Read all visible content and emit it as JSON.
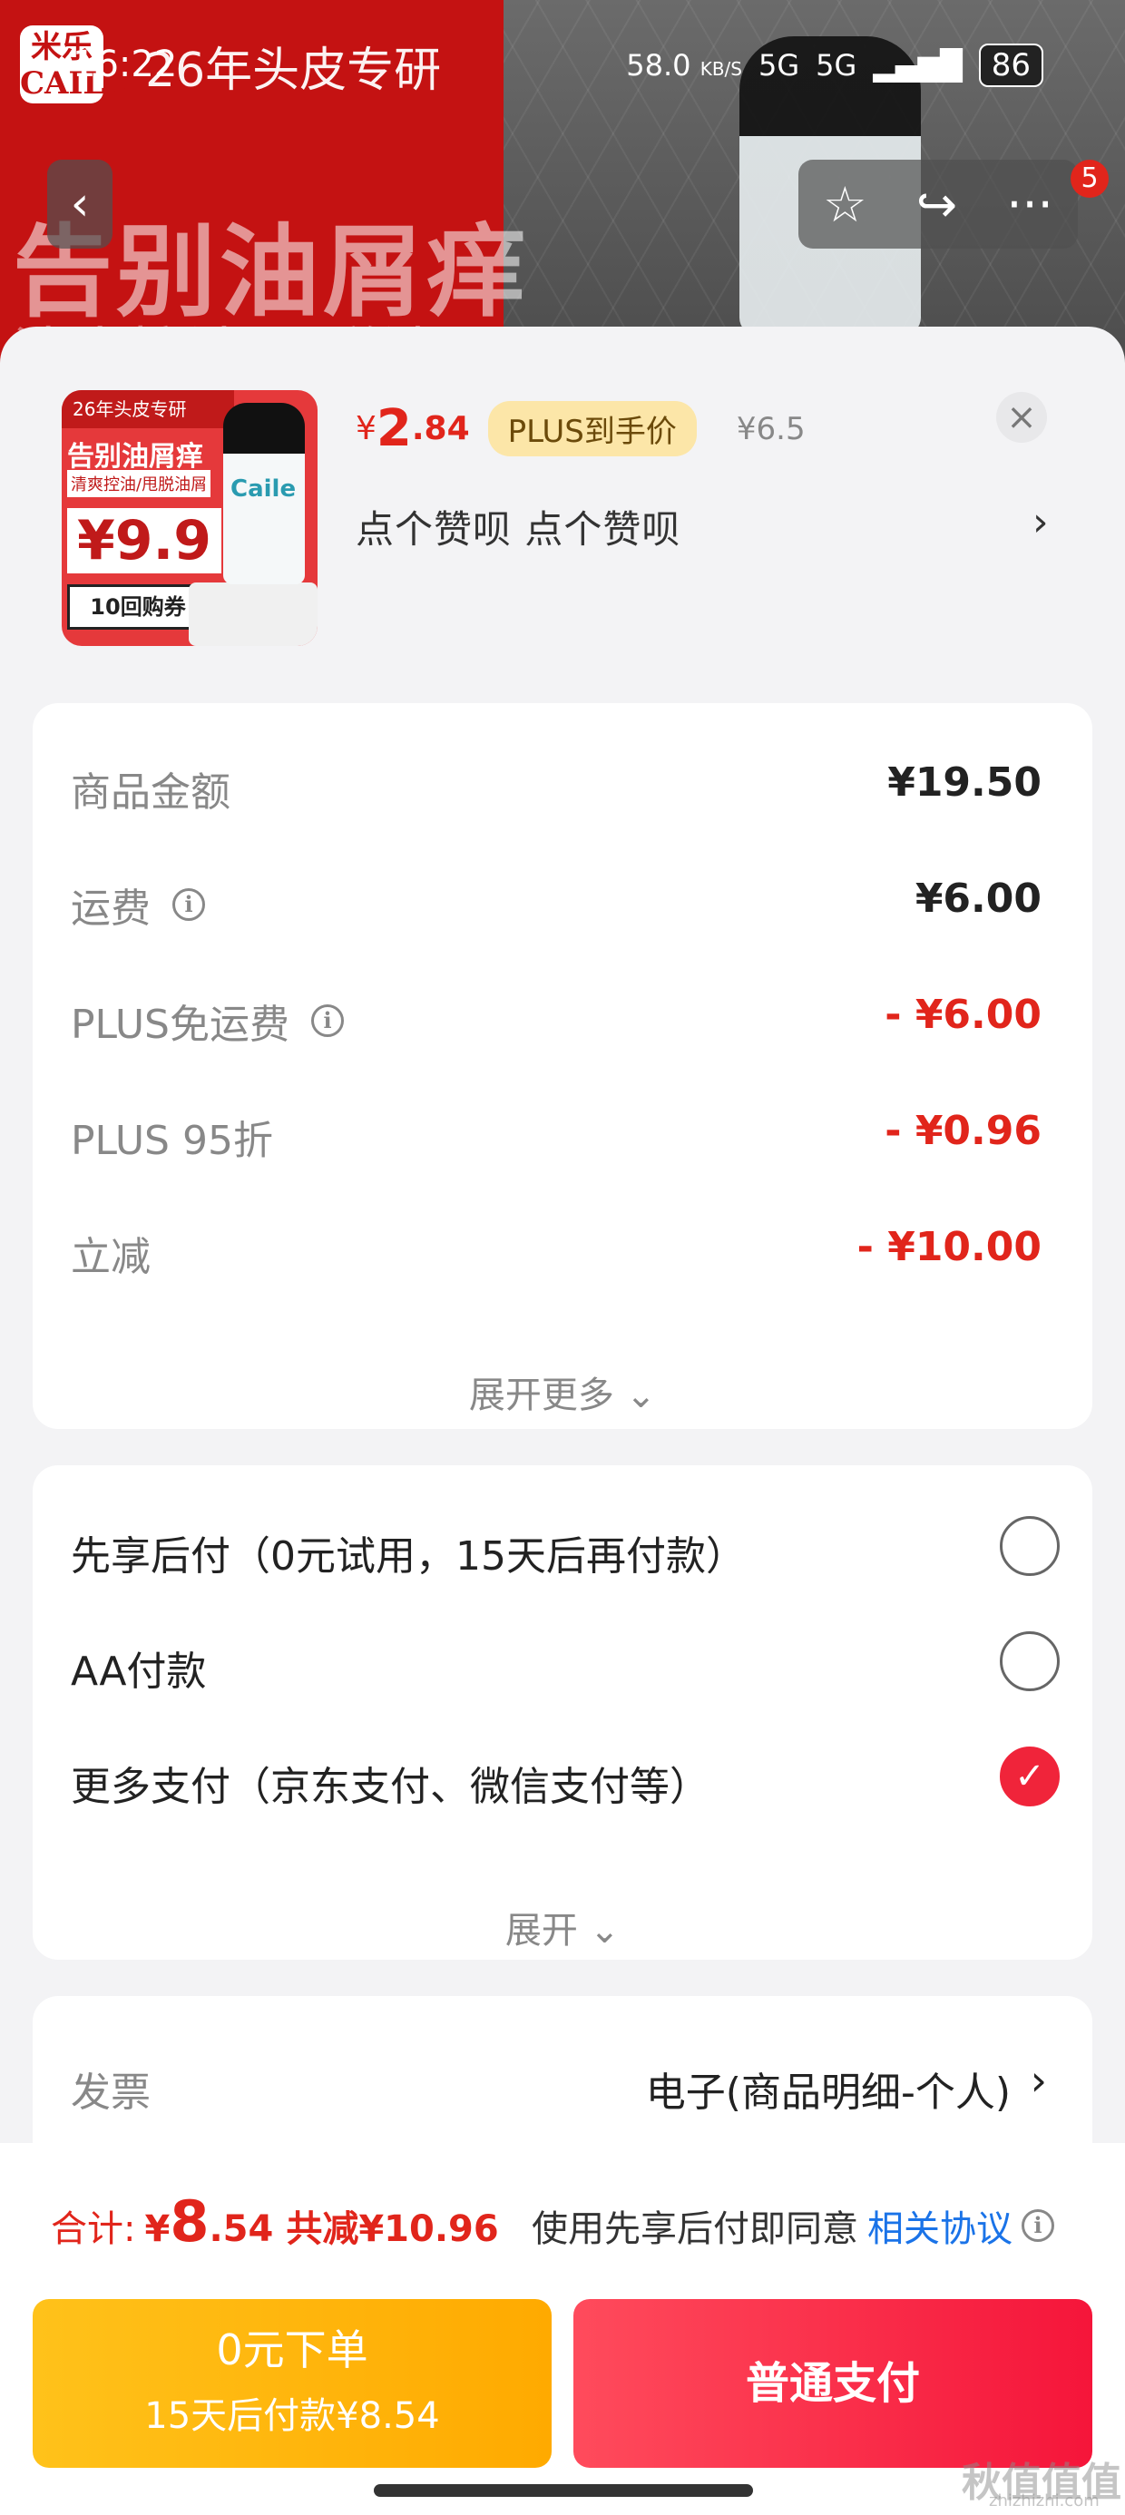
{
  "background": {
    "brand_logo": "米乐\nCAILE",
    "slogan": "26年头皮专研",
    "big_text": "告别油屑痒",
    "sub_text": "清爽控油/甩脱油屑"
  },
  "status_bar": {
    "time": "16:22",
    "net_speed": "58.0",
    "net_unit": "KB/S",
    "signal1": "5G",
    "signal2": "5G",
    "battery": "86"
  },
  "nav": {
    "back_icon": "‹",
    "star_icon": "☆",
    "share_icon": "↪",
    "more_icon": "···",
    "badge_count": "5"
  },
  "product": {
    "thumb_head": "26年头皮专研",
    "thumb_title": "告别油屑痒",
    "thumb_sub": "清爽控油/甩脱油屑",
    "thumb_price": "¥9.9",
    "thumb_coupon": "10回购券",
    "thumb_bottle_label": "Caile",
    "price_symbol": "¥",
    "price_int": "2",
    "price_dec": ".84",
    "plus_tag": "PLUS到手价",
    "original_price": "¥6.5",
    "spec": "点个赞呗  点个赞呗",
    "close_icon": "×",
    "chevron": "›"
  },
  "fees": {
    "rows": [
      {
        "label": "商品金额",
        "value": "¥19.50",
        "info": false,
        "red": false
      },
      {
        "label": "运费",
        "value": "¥6.00",
        "info": true,
        "red": false
      },
      {
        "label": "PLUS免运费",
        "value": "- ¥6.00",
        "info": true,
        "red": true
      },
      {
        "label": "PLUS 95折",
        "value": "- ¥0.96",
        "info": false,
        "red": true
      },
      {
        "label": "立减",
        "value": "- ¥10.00",
        "info": false,
        "red": true
      }
    ],
    "expand_more": "展开更多 ⌄",
    "info_glyph": "i"
  },
  "payment": {
    "options": [
      {
        "label": "先享后付（0元试用，15天后再付款）",
        "checked": false
      },
      {
        "label": "AA付款",
        "checked": false
      },
      {
        "label": "更多支付（京东支付、微信支付等）",
        "checked": true
      }
    ],
    "expand": "展开 ⌄",
    "check_glyph": "✓"
  },
  "invoice": {
    "label": "发票",
    "value": "电子(商品明细-个人)",
    "chevron": "›"
  },
  "bottom": {
    "total_label": "合计:",
    "total_symbol": "¥",
    "total_int": "8",
    "total_dec": ".54",
    "total_save": "共减¥10.96",
    "agree_text": "使用先享后付即同意",
    "agree_link": "相关协议",
    "btn_zero_main": "0元下单",
    "btn_zero_sub": "15天后付款¥8.54",
    "btn_normal": "普通支付"
  },
  "watermark": {
    "text": "秋值值值",
    "sub": "zhizhizhi.com"
  },
  "colors": {
    "accent_red": "#e1251b",
    "pay_red": "#f5153a",
    "gold": "#ffaa00",
    "link_blue": "#1a73e8"
  }
}
